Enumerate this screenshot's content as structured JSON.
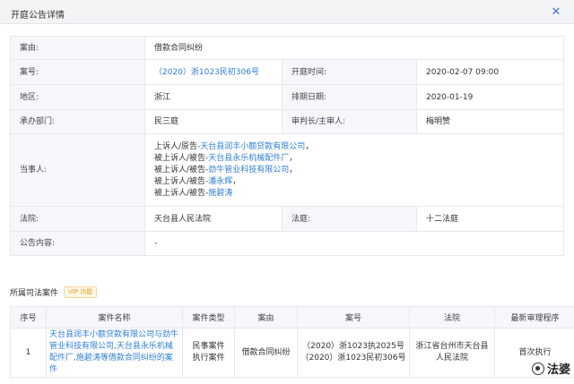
{
  "window": {
    "title": "开庭公告详情",
    "close_icon": "close-icon"
  },
  "detail": {
    "case_reason": {
      "label": "案由:",
      "value": "借款合同纠纷"
    },
    "case_no": {
      "label": "案号:",
      "value": "（2020）浙1023民初306号"
    },
    "hearing_time": {
      "label": "开庭时间:",
      "value": "2020-02-07 09:00"
    },
    "region": {
      "label": "地区:",
      "value": "浙江"
    },
    "schedule_date": {
      "label": "排期日期:",
      "value": "2020-01-19"
    },
    "department": {
      "label": "承办部门:",
      "value": "民三庭"
    },
    "judge": {
      "label": "审判长/主审人:",
      "value": "梅明赞"
    },
    "parties": {
      "label": "当事人:",
      "items": [
        {
          "role": "上诉人/原告-",
          "name": "天台县润丰小额贷款有限公司",
          "sep": "，"
        },
        {
          "role": "被上诉人/被告-",
          "name": "天台县永乐机械配件厂",
          "sep": "，"
        },
        {
          "role": "被上诉人/被告-",
          "name": "劲牛管业科技有限公司",
          "sep": "，"
        },
        {
          "role": "被上诉人/被告-",
          "name": "潘永辉",
          "sep": "，"
        },
        {
          "role": "被上诉人/被告-",
          "name": "施碧涛",
          "sep": ""
        }
      ]
    },
    "court": {
      "label": "法院:",
      "value": "天台县人民法院"
    },
    "courtroom": {
      "label": "法庭:",
      "value": "十二法庭"
    },
    "content": {
      "label": "公告内容:",
      "value": "-"
    }
  },
  "cases_section": {
    "title": "所属司法案件",
    "vip_badge": "VIP 功能"
  },
  "cases_table": {
    "headers": [
      "序号",
      "案件名称",
      "案件类型",
      "案由",
      "案号",
      "法院",
      "最新审理程序"
    ],
    "rows": [
      {
        "index": "1",
        "name": "天台县润丰小额贷款有限公司与劲牛管业科技有限公司,天台县永乐机械配件厂,施碧涛等借款合同纠纷的案件",
        "type_line1": "民事案件",
        "type_line2": "执行案件",
        "reason": "借款合同纠纷",
        "case_no_line1": "（2020）浙1023执2025号",
        "case_no_line2": "（2020）浙1023民初306号",
        "court_line1": "浙江省台州市天台县",
        "court_line2": "人民法院",
        "procedure": "首次执行"
      }
    ]
  },
  "watermark": {
    "text": "法婆",
    "icon": "wechat-channel-icon"
  },
  "colors": {
    "link": "#2e7fd6",
    "label_bg": "#f5f7fa",
    "border": "#e6e8ec",
    "titlebar_bg": "#f3f4f6",
    "vip": "#e0a22c",
    "close": "#4a6ee0"
  }
}
